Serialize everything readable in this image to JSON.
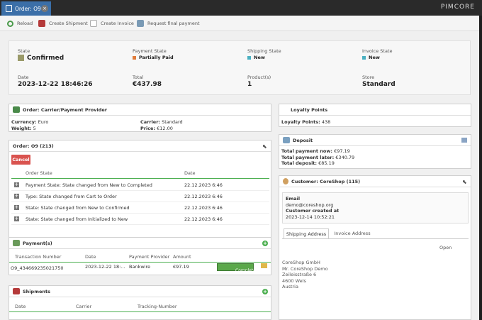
{
  "tab": {
    "title": "Order: O9"
  },
  "brand": "PIMCORE",
  "toolbar": {
    "reload": "Reload",
    "create_shipment": "Create Shipment",
    "create_invoice": "Create Invoice",
    "request_payment": "Request final payment"
  },
  "summary": {
    "state_label": "State",
    "state_value": "Confirmed",
    "payment_label": "Payment State",
    "payment_value": "Partially Paid",
    "shipping_label": "Shipping State",
    "shipping_value": "New",
    "invoice_label": "Invoice State",
    "invoice_value": "New",
    "date_label": "Date",
    "date_value": "2023-12-22 18:46:26",
    "total_label": "Total",
    "total_value": "€437.98",
    "products_label": "Product(s)",
    "products_value": "1",
    "store_label": "Store",
    "store_value": "Standard"
  },
  "colors": {
    "state": "#9a9a6a",
    "payment": "#e07b39",
    "shipping": "#4ab0c1",
    "invoice": "#4ab0c1"
  },
  "carrier": {
    "title": "Order: Carrier/Payment Provider",
    "currency_label": "Currency:",
    "currency": "Euro",
    "weight_label": "Weight:",
    "weight": "5",
    "carrier_label": "Carrier:",
    "carrier": "Standard",
    "price_label": "Price:",
    "price": "€12.00"
  },
  "history": {
    "title": "Order: O9 (213)",
    "cancel": "Cancel",
    "col_state": "Order State",
    "col_date": "Date",
    "rows": [
      {
        "state": "Payment State: State changed from New to Completed",
        "date": "22.12.2023 6:46"
      },
      {
        "state": "Type: State changed from Cart to Order",
        "date": "22.12.2023 6:46"
      },
      {
        "state": "State: State changed from New to Confirmed",
        "date": "22.12.2023 6:46"
      },
      {
        "state": "State: State changed from Initialized to New",
        "date": "22.12.2023 6:46"
      }
    ]
  },
  "payments": {
    "title": "Payment(s)",
    "cols": [
      "Transaction Number",
      "Date",
      "Payment Provider",
      "Amount"
    ],
    "row": {
      "number": "O9_434669235021750",
      "date": "2023-12-22 18:...",
      "provider": "Bankwire",
      "amount": "€97.19",
      "status": "Completed"
    }
  },
  "shipments": {
    "title": "Shipments",
    "cols": [
      "Date",
      "Carrier",
      "Tracking-Number"
    ]
  },
  "loyalty": {
    "title": "Loyalty Points",
    "label": "Loyalty Points:",
    "value": "438"
  },
  "deposit": {
    "title": "Deposit",
    "now_label": "Total payment now:",
    "now": "€97.19",
    "later_label": "Total payment later:",
    "later": "€340.79",
    "deposit_label": "Total deposit:",
    "deposit": "€85.19"
  },
  "customer": {
    "title": "Customer: CoreShop (115)",
    "email_label": "Email",
    "email": "demo@coreshop.org",
    "created_label": "Customer created at",
    "created": "2023-12-14 10:52:21",
    "tab_shipping": "Shipping Address",
    "tab_invoice": "Invoice Address",
    "open": "Open",
    "address": [
      "CoreShop GmbH",
      "Mr. CoreShop Demo",
      "Zeileisstraße 6",
      "4600 Wels",
      "Austria"
    ]
  }
}
